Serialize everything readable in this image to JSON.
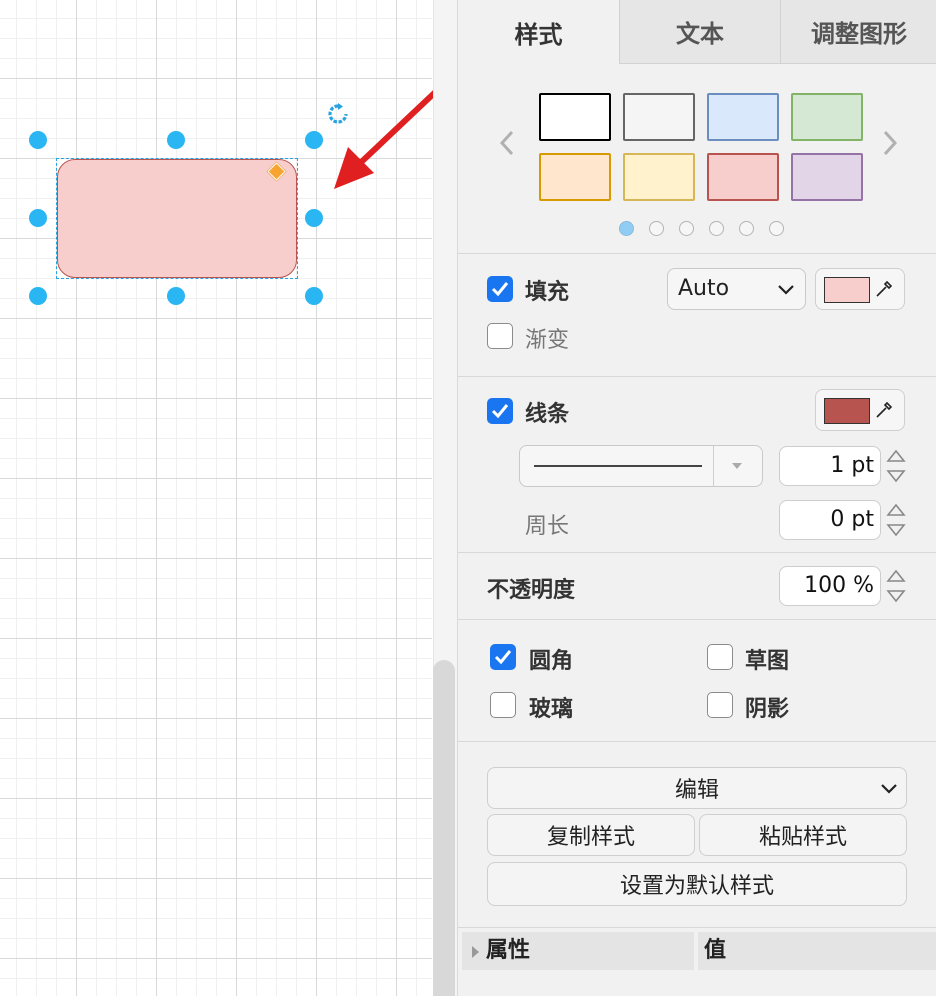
{
  "tabs": [
    {
      "label": "样式",
      "active": true
    },
    {
      "label": "文本",
      "active": false
    },
    {
      "label": "调整图形",
      "active": false
    }
  ],
  "swatches": [
    {
      "fill": "#ffffff",
      "stroke": "#000000"
    },
    {
      "fill": "#f5f5f5",
      "stroke": "#666666"
    },
    {
      "fill": "#dae8fc",
      "stroke": "#6c8ebf"
    },
    {
      "fill": "#d5e8d4",
      "stroke": "#82b366"
    },
    {
      "fill": "#ffe6cc",
      "stroke": "#d79b00"
    },
    {
      "fill": "#fff2cc",
      "stroke": "#d6b656"
    },
    {
      "fill": "#f8cecc",
      "stroke": "#b85450"
    },
    {
      "fill": "#e1d5e7",
      "stroke": "#9673a6"
    }
  ],
  "swatch_pages": {
    "count": 6,
    "current": 1
  },
  "fill": {
    "label": "填充",
    "checked": true,
    "mode": "Auto",
    "color": "#f8cecc"
  },
  "gradient": {
    "label": "渐变",
    "checked": false
  },
  "line": {
    "label": "线条",
    "checked": true,
    "color": "#b85450",
    "width": "1 pt"
  },
  "perimeter": {
    "label": "周长",
    "value": "0 pt"
  },
  "opacity": {
    "label": "不透明度",
    "value": "100 %"
  },
  "options": {
    "rounded": {
      "label": "圆角",
      "checked": true
    },
    "sketch": {
      "label": "草图",
      "checked": false
    },
    "glass": {
      "label": "玻璃",
      "checked": false
    },
    "shadow": {
      "label": "阴影",
      "checked": false
    }
  },
  "actions": {
    "edit": "编辑",
    "copy_style": "复制样式",
    "paste_style": "粘贴样式",
    "set_default": "设置为默认样式"
  },
  "properties": {
    "name_header": "属性",
    "value_header": "值"
  },
  "shape": {
    "fill": "#f8cecc",
    "stroke": "#b85450"
  },
  "accent": "#1976f0",
  "annotation_arrow_color": "#e02020"
}
